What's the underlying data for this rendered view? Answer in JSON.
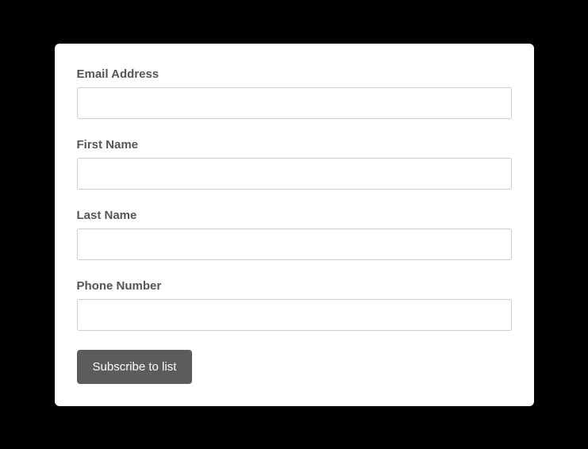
{
  "form": {
    "fields": {
      "email": {
        "label": "Email Address",
        "value": ""
      },
      "firstName": {
        "label": "First Name",
        "value": ""
      },
      "lastName": {
        "label": "Last Name",
        "value": ""
      },
      "phone": {
        "label": "Phone Number",
        "value": ""
      }
    },
    "submitLabel": "Subscribe to list"
  }
}
